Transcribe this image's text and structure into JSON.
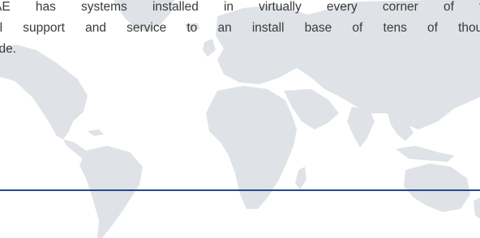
{
  "body_text": {
    "line1": "AE has systems installed in virtually every corner of th",
    "line2": "al support and service to an install base of tens of thous",
    "line3": "ide."
  },
  "map": {
    "icon": "world-map-icon",
    "color": "#dfe2e6"
  },
  "divider": {
    "color": "#254a8c"
  }
}
